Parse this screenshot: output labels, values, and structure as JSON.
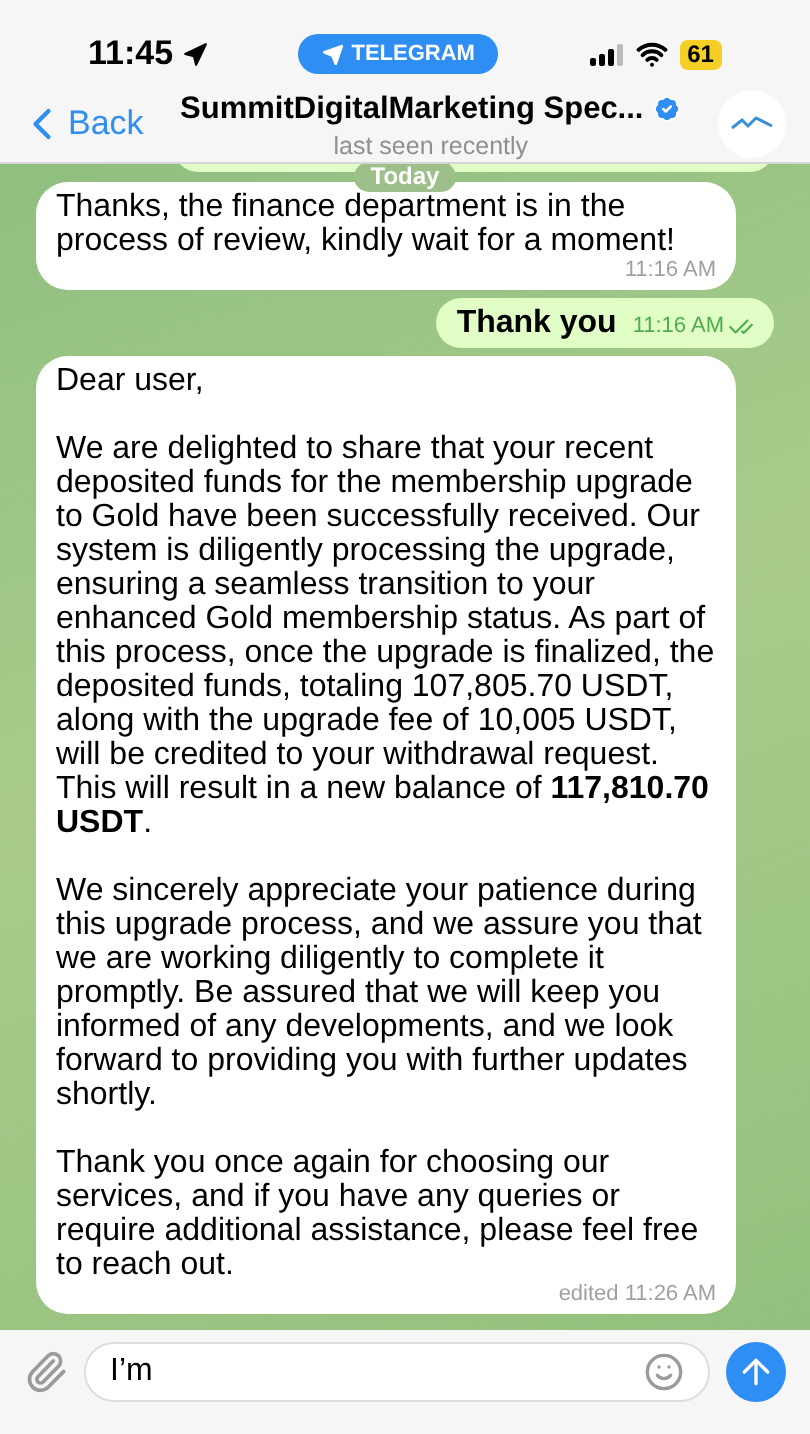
{
  "status_bar": {
    "time": "11:45",
    "app_pill": "TELEGRAM",
    "battery": "61"
  },
  "header": {
    "back": "Back",
    "title": "SummitDigitalMarketing Spec...",
    "verified": true,
    "subtitle": "last seen recently"
  },
  "messages": [
    {
      "kind": "outgoing_cut"
    },
    {
      "kind": "date",
      "text": "Today"
    },
    {
      "kind": "incoming",
      "paragraphs": [
        "Thanks, the finance department is in the process of review, kindly wait for a moment!"
      ],
      "time": "11:16 AM"
    },
    {
      "kind": "outgoing",
      "paragraphs": [
        "Thank you"
      ],
      "time": "11:16 AM",
      "read": true
    },
    {
      "kind": "incoming",
      "paragraphs": [
        "Dear user,",
        "We are delighted to share that your recent deposited funds for the membership upgrade to Gold have been successfully received. Our system is diligently processing the upgrade, ensuring a seamless transition to your enhanced Gold membership status. As part of this process, once the upgrade is finalized, the deposited funds, totaling 107,805.70 USDT, along with the upgrade fee of 10,005 USDT, will be credited to your withdrawal request. This will result in a new balance of **117,810.70 USDT**.",
        "We sincerely appreciate your patience during this upgrade process, and we assure you that we are working diligently to complete it promptly. Be assured that we will keep you informed of any developments, and we look forward to providing you with further updates shortly.",
        "Thank you once again for choosing our services, and if you have any queries or require additional assistance, please feel free to reach out."
      ],
      "time": "edited 11:26 AM"
    }
  ],
  "composer": {
    "value": "I’m"
  }
}
